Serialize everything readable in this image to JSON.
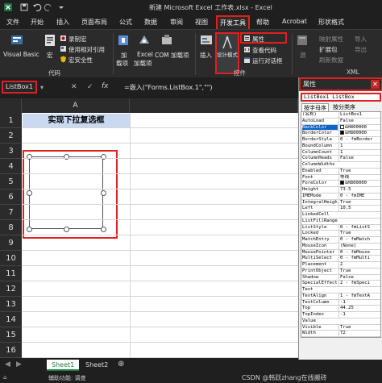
{
  "title_bar": {
    "title": "新建 Microsoft Excel 工作表.xlsx  -  Excel"
  },
  "menu": {
    "items": [
      "文件",
      "开始",
      "插入",
      "页面布局",
      "公式",
      "数据",
      "审阅",
      "视图",
      "开发工具",
      "帮助",
      "Acrobat",
      "形状格式"
    ],
    "active": "开发工具"
  },
  "ribbon": {
    "visual_basic": "Visual Basic",
    "macro": "宏",
    "record_macro": "录制宏",
    "relative_ref": "使用相对引用",
    "macro_security": "宏安全性",
    "group_code": "代码",
    "addins_1": "加",
    "addins_2": "载项",
    "excel_addins_1": "Excel",
    "excel_addins_2": "加载项",
    "com_addins": "COM 加载项",
    "insert": "插入",
    "design_mode_1": "设计模式",
    "properties": "属性",
    "view_code": "查看代码",
    "run_dialog": "运行对话框",
    "group_controls": "控件",
    "source": "源",
    "map_props": "映射属性",
    "expansion_packs": "扩展包",
    "refresh_data": "刷新数据",
    "import": "导入",
    "export": "导出",
    "group_xml": "XML"
  },
  "formula_bar": {
    "name_box": "ListBox1",
    "cancel": "✕",
    "enter": "✓",
    "fx": "fx",
    "formula": "=嵌入(\"Forms.ListBox.1\",\"\")"
  },
  "sheet": {
    "column_a": "A",
    "rows": [
      "1",
      "2",
      "3",
      "4",
      "5",
      "6",
      "7",
      "8",
      "9",
      "10",
      "11",
      "12",
      "13",
      "14",
      "15",
      "16"
    ],
    "a1_text": "实现下拉复选框",
    "a1_fill": "#c9d9f0",
    "listbox_name": "ListBox1"
  },
  "properties_panel": {
    "title": "属性",
    "close": "✕",
    "object": "ListBox1 ListBox",
    "tabs": [
      "按字母序",
      "按分类序"
    ],
    "rows": [
      {
        "name": "(名称)",
        "value": "ListBox1"
      },
      {
        "name": "AutoLoad",
        "value": "False"
      },
      {
        "name": "BackColor",
        "value": "&H800000",
        "swatch": "#ffffff",
        "selected": true
      },
      {
        "name": "BorderColor",
        "value": "&H800000",
        "swatch": "#000000"
      },
      {
        "name": "BorderStyle",
        "value": "0 - fmBorder"
      },
      {
        "name": "BoundColumn",
        "value": "1"
      },
      {
        "name": "ColumnCount",
        "value": "1"
      },
      {
        "name": "ColumnHeads",
        "value": "False"
      },
      {
        "name": "ColumnWidths",
        "value": ""
      },
      {
        "name": "Enabled",
        "value": "True"
      },
      {
        "name": "Font",
        "value": "等线"
      },
      {
        "name": "ForeColor",
        "value": "&H800000",
        "swatch": "#000000"
      },
      {
        "name": "Height",
        "value": "73.5"
      },
      {
        "name": "IMEMode",
        "value": "0 - fmIME"
      },
      {
        "name": "IntegralHeight",
        "value": "True"
      },
      {
        "name": "Left",
        "value": "10.5"
      },
      {
        "name": "LinkedCell",
        "value": ""
      },
      {
        "name": "ListFillRange",
        "value": ""
      },
      {
        "name": "ListStyle",
        "value": "0 - fmListS"
      },
      {
        "name": "Locked",
        "value": "True"
      },
      {
        "name": "MatchEntry",
        "value": "0 - fmMatch"
      },
      {
        "name": "MouseIcon",
        "value": "(None)"
      },
      {
        "name": "MousePointer",
        "value": "0 - fmMouse"
      },
      {
        "name": "MultiSelect",
        "value": "0 - fmMulti"
      },
      {
        "name": "Placement",
        "value": "2"
      },
      {
        "name": "PrintObject",
        "value": "True"
      },
      {
        "name": "Shadow",
        "value": "False"
      },
      {
        "name": "SpecialEffect",
        "value": "2 - fmSpeci"
      },
      {
        "name": "Text",
        "value": ""
      },
      {
        "name": "TextAlign",
        "value": "1 - fmTextA"
      },
      {
        "name": "TextColumn",
        "value": "-1"
      },
      {
        "name": "Top",
        "value": "44.25"
      },
      {
        "name": "TopIndex",
        "value": "-1"
      },
      {
        "name": "Value",
        "value": ""
      },
      {
        "name": "Visible",
        "value": "True"
      },
      {
        "name": "Width",
        "value": "72"
      }
    ]
  },
  "sheet_tabs": [
    "Sheet1",
    "Sheet2"
  ],
  "status": {
    "text": "辅助功能: 调查"
  },
  "watermark": "CSDN @韩跃zhang在线搬砖"
}
